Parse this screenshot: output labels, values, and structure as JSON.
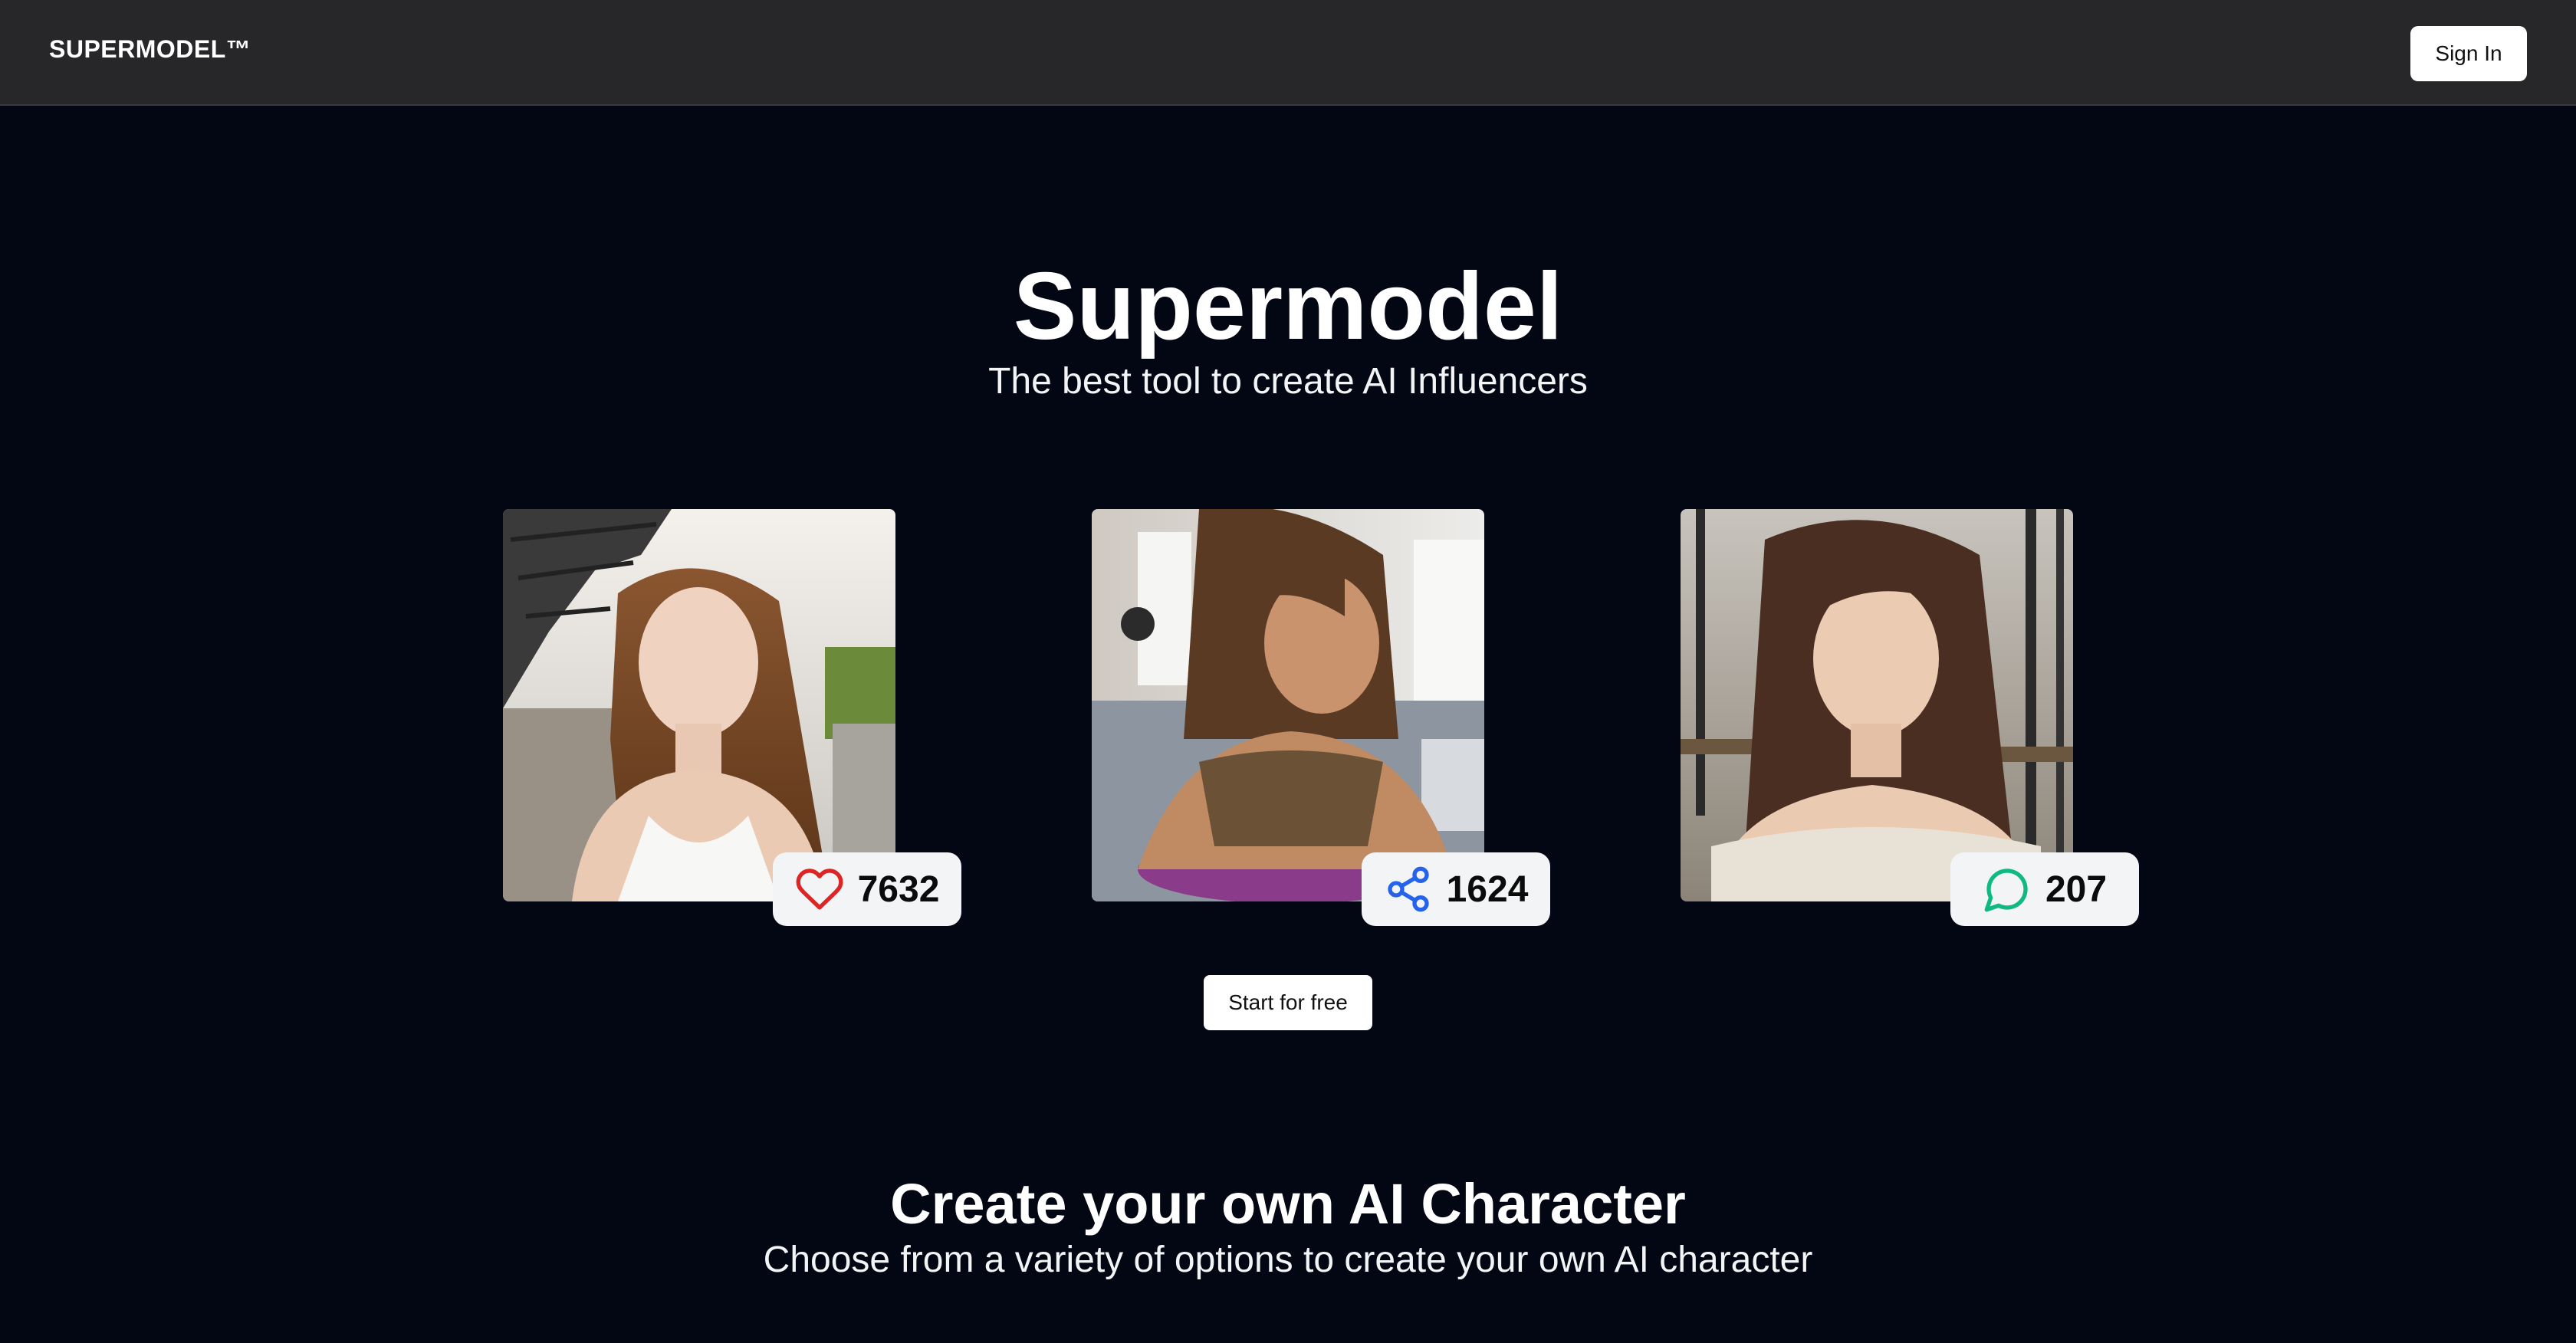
{
  "header": {
    "brand": "SUPERMODEL™",
    "sign_in_label": "Sign In"
  },
  "hero": {
    "title": "Supermodel",
    "subtitle": "The best tool to create AI Influencers"
  },
  "showcase": [
    {
      "stat": "7632",
      "icon": "heart-icon",
      "icon_color": "#dc2626"
    },
    {
      "stat": "1624",
      "icon": "share-icon",
      "icon_color": "#2563eb"
    },
    {
      "stat": "207",
      "icon": "chat-bubble-icon",
      "icon_color": "#10b981"
    }
  ],
  "cta": {
    "start_label": "Start for free"
  },
  "section": {
    "title": "Create your own AI Character",
    "subtitle": "Choose from a variety of options to create your own AI character"
  }
}
